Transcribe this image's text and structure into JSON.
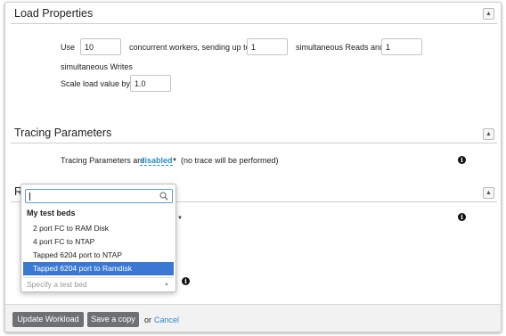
{
  "load_properties": {
    "title": "Load Properties",
    "use_label": "Use",
    "workers_value": "10",
    "workers_text": "concurrent workers, sending up to",
    "reads_value": "1",
    "reads_text": "simultaneous Reads and",
    "writes_value": "1",
    "writes_text": "simultaneous Writes",
    "scale_label": "Scale load value by",
    "scale_value": "1.0"
  },
  "tracing": {
    "title": "Tracing Parameters",
    "label": "Tracing Parameters are",
    "value": "disabled",
    "note": "(no trace will be performed)"
  },
  "third_section": {
    "title_partial": "R"
  },
  "testbed_dropdown": {
    "search_value": "",
    "group_label": "My test beds",
    "options": [
      "2 port FC to RAM Disk",
      "4 port FC to NTAP",
      "Tapped 6204 port to NTAP",
      "Tapped 6204 port to Ramdisk"
    ],
    "selected_index": 3,
    "placeholder": "Specify a test bed"
  },
  "footer": {
    "update_label": "Update Workload",
    "save_label": "Save a copy",
    "or_text": "or",
    "cancel_label": "Cancel"
  },
  "icons": {
    "collapse": "double-chevron-up-icon",
    "info": "info-icon",
    "search": "search-icon",
    "caret": "caret-down-icon"
  },
  "colors": {
    "link": "#2a8bc4",
    "selected_option": "#3b78d4",
    "button_bg": "#6f7072"
  }
}
